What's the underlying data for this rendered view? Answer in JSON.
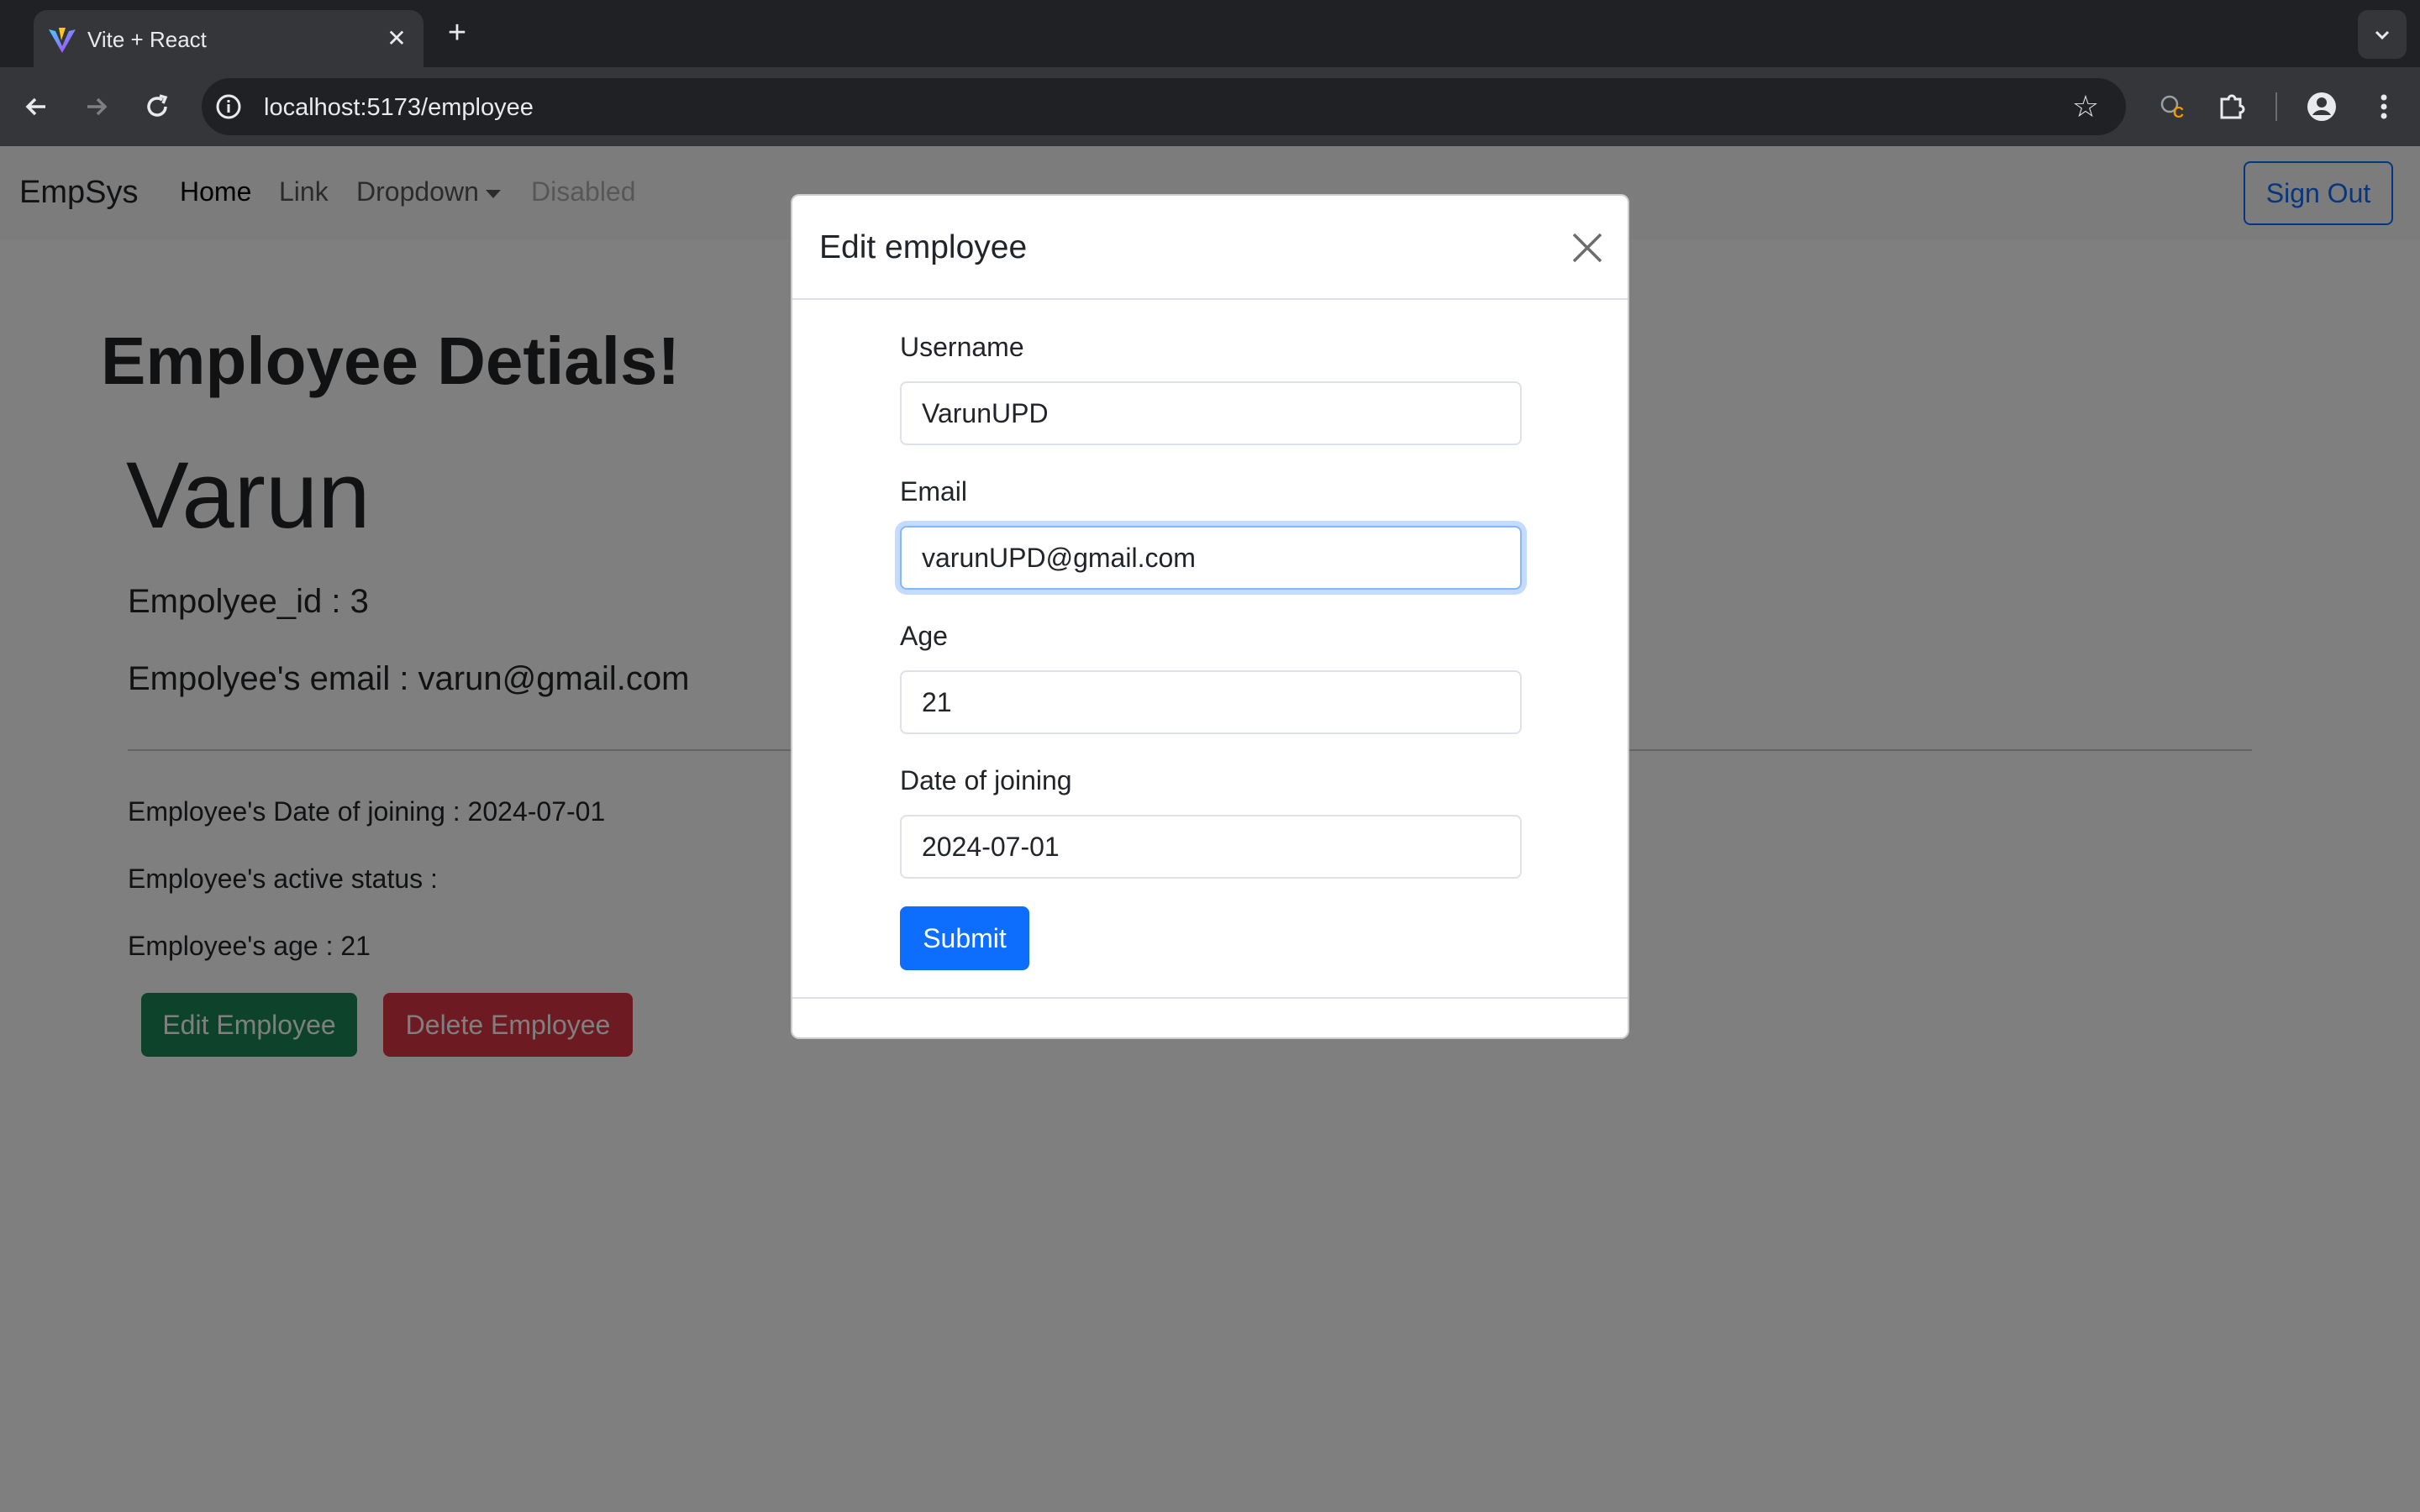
{
  "browser": {
    "tab_title": "Vite + React",
    "url": "localhost:5173/employee"
  },
  "navbar": {
    "brand": "EmpSys",
    "links": {
      "home": "Home",
      "link": "Link",
      "dropdown": "Dropdown",
      "disabled": "Disabled"
    },
    "sign_out": "Sign Out"
  },
  "employee": {
    "heading": "Employee Detials!",
    "name": "Varun",
    "id_line": "Empolyee_id : 3",
    "email_line": "Empolyee's email : varun@gmail.com",
    "doj_line": "Employee's Date of joining : 2024-07-01",
    "active_line": "Employee's active status :",
    "age_line": "Employee's age : 21",
    "edit_button": "Edit Employee",
    "delete_button": "Delete Employee"
  },
  "modal": {
    "title": "Edit employee",
    "fields": {
      "username": {
        "label": "Username",
        "value": "VarunUPD"
      },
      "email": {
        "label": "Email",
        "value": "varunUPD@gmail.com"
      },
      "age": {
        "label": "Age",
        "value": "21"
      },
      "doj": {
        "label": "Date of joining",
        "value": "2024-07-01"
      }
    },
    "submit": "Submit"
  },
  "colors": {
    "primary": "#0d6efd",
    "success": "#198754",
    "danger": "#dc3545",
    "chrome_dark": "#202124",
    "chrome_toolbar": "#35363a"
  },
  "icons": [
    "vite-favicon-icon",
    "close-tab-icon",
    "plus-icon",
    "chevron-down-icon",
    "back-icon",
    "forward-icon",
    "reload-icon",
    "info-icon",
    "star-icon",
    "extension-c-icon",
    "puzzle-icon",
    "profile-icon",
    "more-vert-icon",
    "close-icon"
  ]
}
